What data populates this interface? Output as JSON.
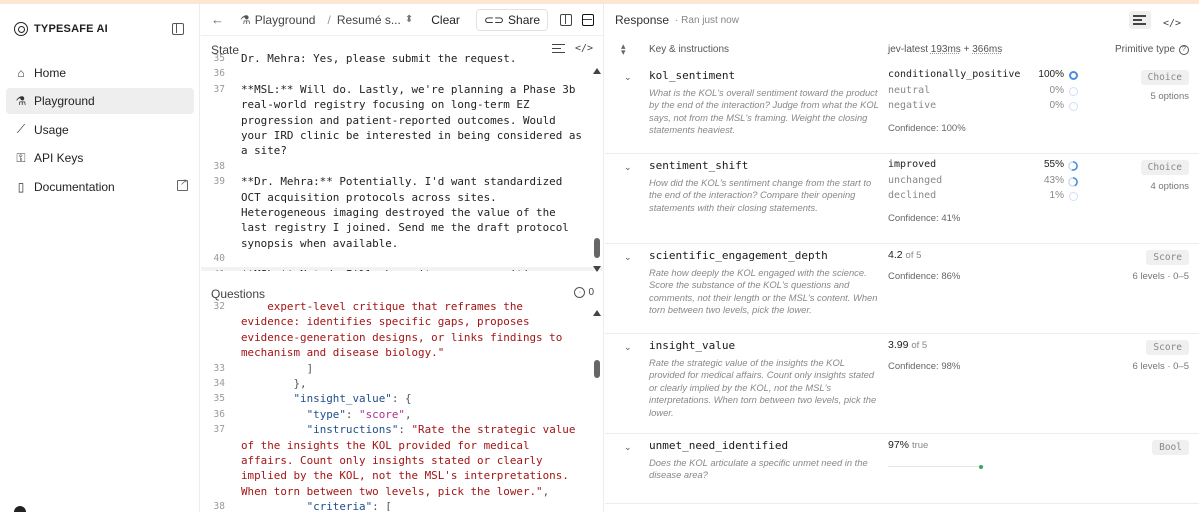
{
  "app": {
    "brand_name": "TYPESAFE AI",
    "nav": [
      {
        "label": "Home",
        "icon": "home-icon",
        "glyph": "⌂",
        "active": false
      },
      {
        "label": "Playground",
        "icon": "flask-icon",
        "glyph": "⚗",
        "active": true
      },
      {
        "label": "Usage",
        "icon": "chart-line-icon",
        "glyph": "⟋",
        "active": false
      },
      {
        "label": "API Keys",
        "icon": "key-icon",
        "glyph": "⚿",
        "active": false
      },
      {
        "label": "Documentation",
        "icon": "book-icon",
        "glyph": "▯",
        "active": false
      }
    ]
  },
  "toolbar": {
    "crumb_root": "Playground",
    "crumb_current": "Resumé s...",
    "clear_label": "Clear",
    "share_label": "Share"
  },
  "state": {
    "title": "State",
    "lines": [
      {
        "ln": "35",
        "text": "Dr. Mehra: Yes, please submit the request.",
        "hl": false
      },
      {
        "ln": "36",
        "text": "",
        "hl": false
      },
      {
        "ln": "37",
        "text": "**MSL:** Will do. Lastly, we're planning a Phase 3b real-world registry focusing on long-term EZ progression and patient-reported outcomes. Would your IRD clinic be interested in being considered as a site?",
        "hl": false
      },
      {
        "ln": "38",
        "text": "",
        "hl": false
      },
      {
        "ln": "39",
        "text": "**Dr. Mehra:** Potentially. I'd want standardized OCT acquisition protocols across sites. Heterogeneous imaging destroyed the value of the last registry I joined. Send me the draft protocol synopsis when available.",
        "hl": false
      },
      {
        "ln": "40",
        "text": "",
        "hl": false
      },
      {
        "ln": "41",
        "text": "**MSL:** Noted. I'll share it as soon as it's approved for external distribution.",
        "hl": true
      }
    ]
  },
  "questions": {
    "title": "Questions",
    "count": "0",
    "lines": [
      {
        "ln": "32",
        "parts": [
          {
            "c": "str",
            "t": "    expert-level critique that reframes the evidence: identifies specific gaps, proposes evidence-generation designs, or links findings to mechanism and disease biology.\""
          }
        ]
      },
      {
        "ln": "33",
        "parts": [
          {
            "c": "punc",
            "t": "          ]"
          }
        ]
      },
      {
        "ln": "34",
        "parts": [
          {
            "c": "punc",
            "t": "        },"
          }
        ]
      },
      {
        "ln": "35",
        "parts": [
          {
            "c": "key",
            "t": "        \"insight_value\""
          },
          {
            "c": "punc",
            "t": ": {"
          }
        ]
      },
      {
        "ln": "36",
        "parts": [
          {
            "c": "key",
            "t": "          \"type\""
          },
          {
            "c": "punc",
            "t": ": "
          },
          {
            "c": "val",
            "t": "\"score\""
          },
          {
            "c": "punc",
            "t": ","
          }
        ]
      },
      {
        "ln": "37",
        "parts": [
          {
            "c": "key",
            "t": "          \"instructions\""
          },
          {
            "c": "punc",
            "t": ": "
          },
          {
            "c": "str",
            "t": "\"Rate the strategic value of the insights the KOL provided for medical affairs. Count only insights stated or clearly implied by the KOL, not the MSL's interpretations. When torn between two levels, pick the lower.\""
          },
          {
            "c": "punc",
            "t": ","
          }
        ]
      },
      {
        "ln": "38",
        "parts": [
          {
            "c": "key",
            "t": "          \"criteria\""
          },
          {
            "c": "punc",
            "t": ": ["
          }
        ]
      }
    ]
  },
  "response": {
    "title": "Response",
    "ran": "· Ran just now",
    "col_key": "Key & instructions",
    "col_model_prefix": "jev-latest",
    "col_latency_a": "193ms",
    "col_latency_sep": " + ",
    "col_latency_b": "366ms",
    "col_type": "Primitive type",
    "rows": [
      {
        "key": "kol_sentiment",
        "desc": "What is the KOL's overall sentiment toward the product by the end of the interaction? Judge from what the KOL says, not from the MSL's framing. Weight the closing statements heaviest.",
        "kind": "choice",
        "options": [
          {
            "label": "conditionally_positive",
            "pct": "100%",
            "pct_value": 100
          },
          {
            "label": "neutral",
            "pct": "0%",
            "pct_value": 0
          },
          {
            "label": "negative",
            "pct": "0%",
            "pct_value": 0
          }
        ],
        "confidence": "Confidence: 100%",
        "badge": "Choice",
        "sub": "5 options"
      },
      {
        "key": "sentiment_shift",
        "desc": "How did the KOL's sentiment change from the start to the end of the interaction? Compare their opening statements with their closing statements.",
        "kind": "choice",
        "options": [
          {
            "label": "improved",
            "pct": "55%",
            "pct_value": 55
          },
          {
            "label": "unchanged",
            "pct": "43%",
            "pct_value": 43
          },
          {
            "label": "declined",
            "pct": "1%",
            "pct_value": 1
          }
        ],
        "confidence": "Confidence: 41%",
        "badge": "Choice",
        "sub": "4 options"
      },
      {
        "key": "scientific_engagement_depth",
        "desc": "Rate how deeply the KOL engaged with the science. Score the substance of the KOL's questions and comments, not their length or the MSL's content. When torn between two levels, pick the lower.",
        "kind": "score",
        "score": "4.2",
        "score_of": "of 5",
        "confidence": "Confidence: 86%",
        "badge": "Score",
        "sub": "6 levels · 0–5"
      },
      {
        "key": "insight_value",
        "desc": "Rate the strategic value of the insights the KOL provided for medical affairs. Count only insights stated or clearly implied by the KOL, not the MSL's interpretations. When torn between two levels, pick the lower.",
        "kind": "score",
        "score": "3.99",
        "score_of": "of 5",
        "confidence": "Confidence: 98%",
        "badge": "Score",
        "sub": "6 levels · 0–5"
      },
      {
        "key": "unmet_need_identified",
        "desc": "Does the KOL articulate a specific unmet need in the disease area?",
        "kind": "bool",
        "score": "97%",
        "score_of": "true",
        "slider_value": 97,
        "badge": "Bool",
        "sub": ""
      }
    ]
  },
  "colors": {
    "accent_ring": "#4a8fdc",
    "accent_ring_light": "#cfe0f5",
    "true_dot": "#3aa655"
  }
}
